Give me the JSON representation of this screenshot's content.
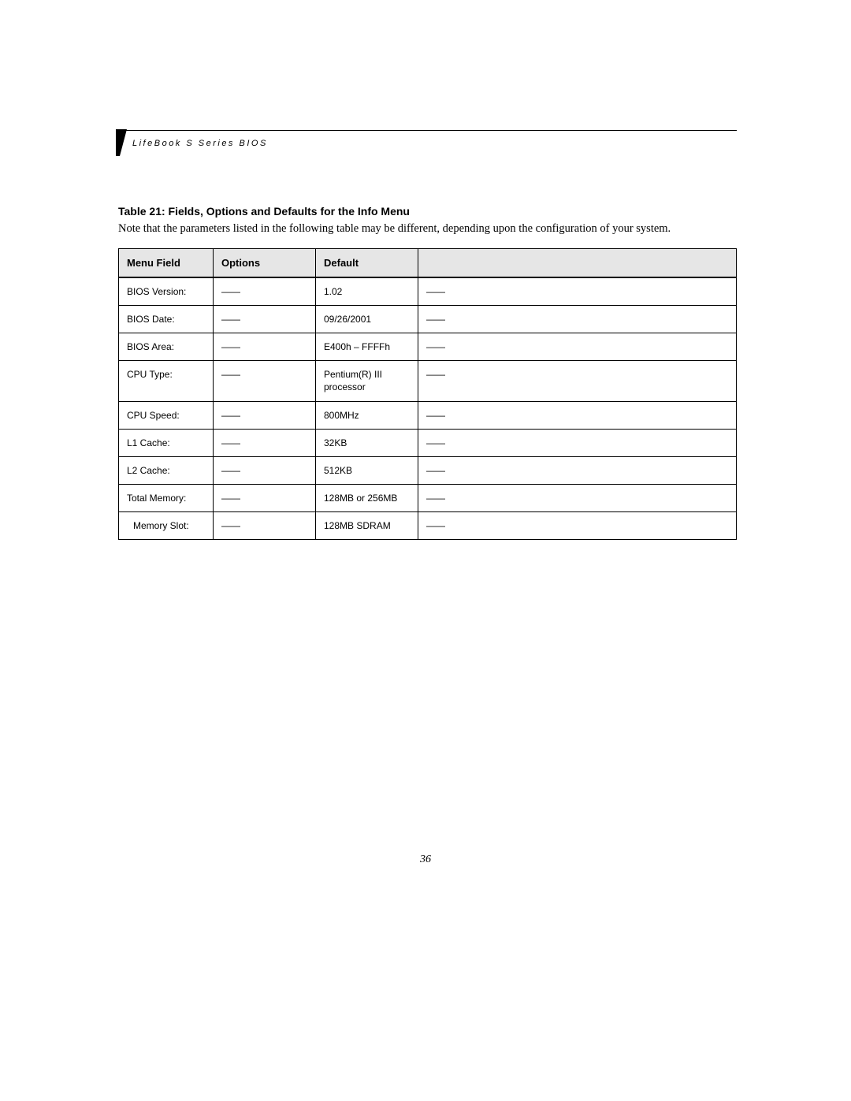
{
  "header": {
    "text": "LifeBook S Series BIOS"
  },
  "table": {
    "title": "Table 21: Fields, Options and Defaults for the Info Menu",
    "note": "Note that the parameters listed in the following table may be different, depending upon the configuration of your system.",
    "columns": {
      "menu_field": "Menu Field",
      "options": "Options",
      "default": "Default",
      "blank": ""
    },
    "rows": [
      {
        "menu_field": "BIOS Version:",
        "options": "——",
        "default": "1.02",
        "desc": "——",
        "indent": false
      },
      {
        "menu_field": "BIOS Date:",
        "options": "——",
        "default": "09/26/2001",
        "desc": "——",
        "indent": false
      },
      {
        "menu_field": "BIOS Area:",
        "options": "——",
        "default": "E400h – FFFFh",
        "desc": "——",
        "indent": false
      },
      {
        "menu_field": "CPU Type:",
        "options": "——",
        "default": "Pentium(R) III processor",
        "desc": "——",
        "indent": false
      },
      {
        "menu_field": "CPU Speed:",
        "options": "——",
        "default": "800MHz",
        "desc": "——",
        "indent": false
      },
      {
        "menu_field": "L1 Cache:",
        "options": "——",
        "default": "32KB",
        "desc": "——",
        "indent": false
      },
      {
        "menu_field": "L2 Cache:",
        "options": "——",
        "default": "512KB",
        "desc": "——",
        "indent": false
      },
      {
        "menu_field": "Total Memory:",
        "options": "——",
        "default": "128MB or 256MB",
        "desc": "——",
        "indent": false
      },
      {
        "menu_field": "Memory Slot:",
        "options": "——",
        "default": "128MB SDRAM",
        "desc": "——",
        "indent": true
      }
    ]
  },
  "page_number": "36"
}
